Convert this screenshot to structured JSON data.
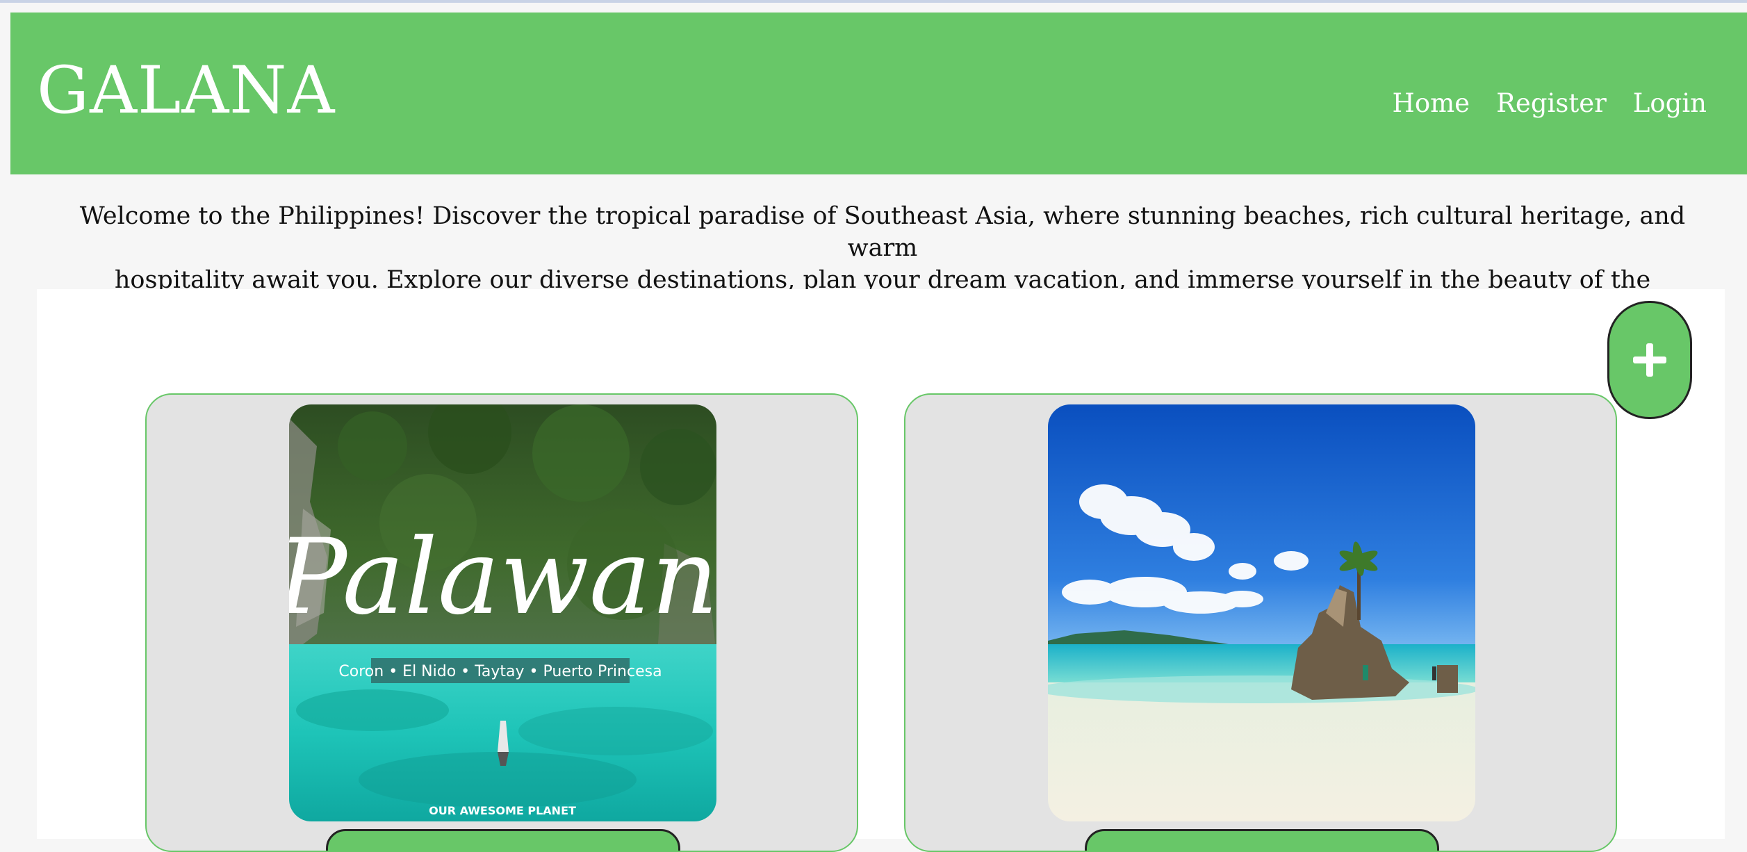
{
  "brand": {
    "title": "GALANA"
  },
  "nav": {
    "items": [
      "Home",
      "Register",
      "Login"
    ]
  },
  "intro": {
    "line1": "Welcome to the Philippines! Discover the tropical paradise of Southeast Asia, where stunning beaches, rich cultural heritage, and warm",
    "line2": "hospitality await you. Explore our diverse destinations, plan your dream vacation, and immerse yourself in the beauty of the Philippines."
  },
  "add_button": {
    "icon": "plus-icon"
  },
  "cards": [
    {
      "image": {
        "title": "Palawan",
        "subtitle": "Coron • El Nido • Taytay • Puerto Princesa",
        "watermark": "OUR AWESOME PLANET"
      }
    },
    {
      "image": {}
    }
  ],
  "colors": {
    "brand_green": "#68c768",
    "card_bg": "#e3e3e3",
    "page_bg": "#f6f6f6"
  }
}
